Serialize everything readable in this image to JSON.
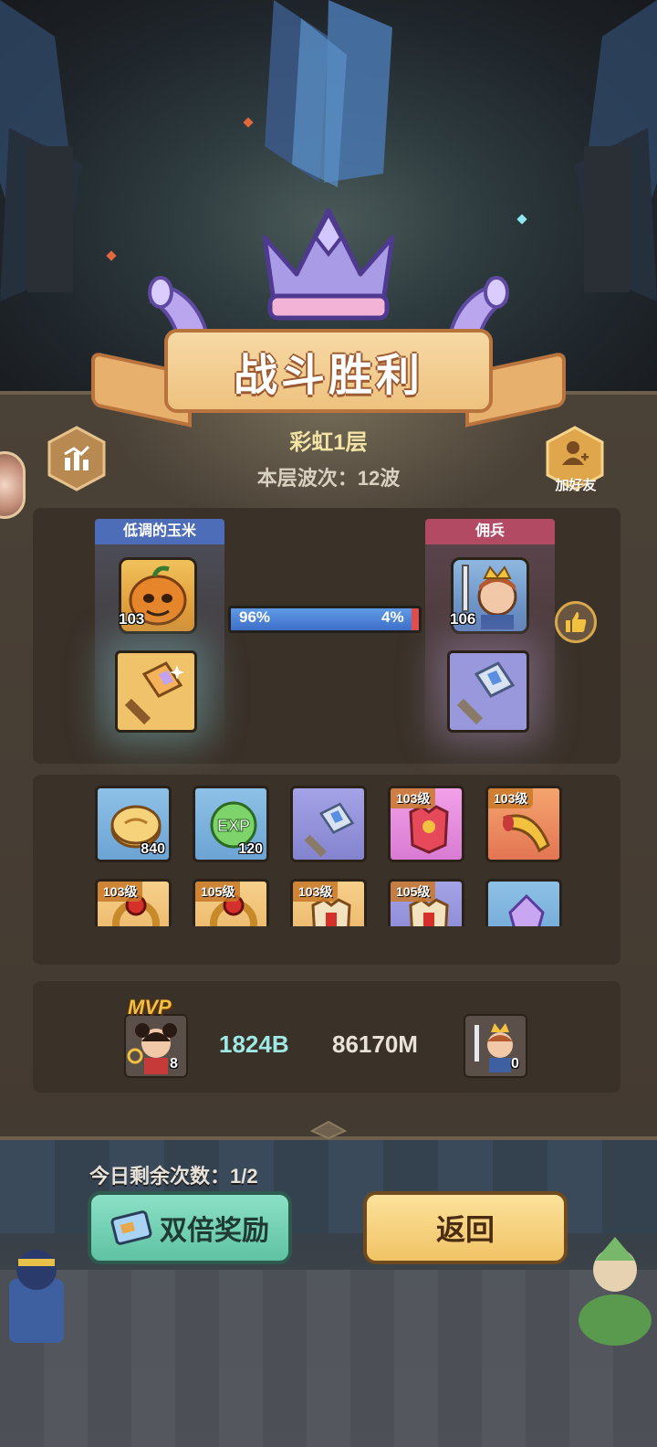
{
  "banner": {
    "title": "战斗胜利"
  },
  "stage": {
    "floor": "彩虹1层",
    "wave_text": "本层波次：12波"
  },
  "header": {
    "stats_icon": "bar-chart-icon",
    "add_friend_label": "加好友"
  },
  "battle": {
    "left_team": {
      "name": "低调的玉米",
      "hero_level": "103",
      "color": "#4e6db8"
    },
    "right_team": {
      "name": "佣兵",
      "hero_level": "106",
      "color": "#b24a63"
    },
    "damage_share": {
      "left_label": "96%",
      "right_label": "4%",
      "left_fraction": 0.96
    }
  },
  "rewards": [
    {
      "type": "coin",
      "count": "840",
      "rarity": "blue"
    },
    {
      "type": "exp",
      "count": "120",
      "rarity": "blue",
      "icon_text": "EXP"
    },
    {
      "type": "hammer",
      "rarity": "purple"
    },
    {
      "type": "armor",
      "level": "103级",
      "rarity": "pink"
    },
    {
      "type": "horn",
      "level": "103级",
      "rarity": "red"
    },
    {
      "type": "ring",
      "level": "103级",
      "rarity": "gold"
    },
    {
      "type": "ring",
      "level": "105级",
      "rarity": "gold"
    },
    {
      "type": "armor",
      "level": "103级",
      "rarity": "gold"
    },
    {
      "type": "armor",
      "level": "105级",
      "rarity": "purple"
    },
    {
      "type": "crystal",
      "rarity": "blue"
    }
  ],
  "mvp": {
    "badge": "MVP",
    "left_count": "8",
    "left_value": "1824B",
    "right_value": "86170M",
    "right_count": "0"
  },
  "footer": {
    "remaining_text": "今日剩余次数：1/2",
    "double_reward_label": "双倍奖励",
    "back_label": "返回"
  },
  "colors": {
    "accent_blue": "#4e6db8",
    "accent_red": "#b24a63",
    "teal_button": "#6fcfb1",
    "gold_button": "#f5cf78"
  }
}
